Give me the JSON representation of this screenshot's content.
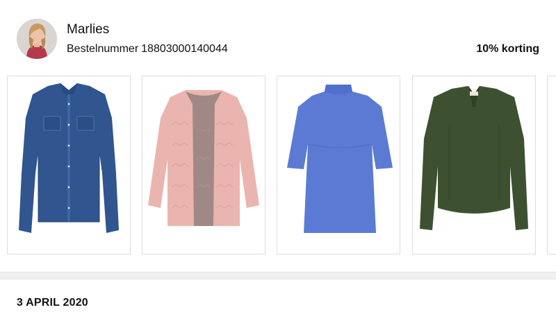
{
  "order": {
    "customer_name": "Marlies",
    "order_label": "Bestelnummer",
    "order_number": "18803000140044",
    "discount": "10% korting"
  },
  "products": [
    {
      "icon": "denim-shirt-icon",
      "color": "#2f5591"
    },
    {
      "icon": "pink-cardigan-icon",
      "color": "#e8b3ad"
    },
    {
      "icon": "blue-top-icon",
      "color": "#5b7ad6"
    },
    {
      "icon": "green-blouse-icon",
      "color": "#3f5230"
    }
  ],
  "next_order": {
    "date": "3 APRIL 2020"
  }
}
